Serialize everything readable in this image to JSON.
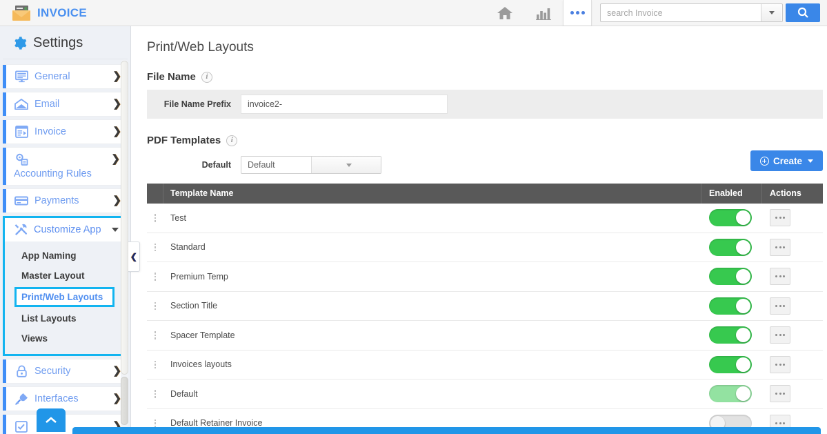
{
  "header": {
    "brand": "INVOICE",
    "logo_icon": "envelope-invoice-icon",
    "home_icon": "home-icon",
    "reports_icon": "bar-chart-icon",
    "more_icon": "more-horizontal-icon",
    "search": {
      "placeholder": "search Invoice",
      "value": "",
      "dropdown_icon": "chevron-down-icon",
      "button_icon": "search-icon"
    }
  },
  "sidebar": {
    "title": "Settings",
    "gear_icon": "gear-icon",
    "items": [
      {
        "label": "General",
        "icon": "monitor-icon",
        "chevron": "❯"
      },
      {
        "label": "Email",
        "icon": "envelope-icon",
        "chevron": "❯"
      },
      {
        "label": "Invoice",
        "icon": "invoice-document-icon",
        "chevron": "❯"
      },
      {
        "label": "Accounting Rules",
        "icon": "gears-icon",
        "chevron": "❯"
      },
      {
        "label": "Payments",
        "icon": "credit-card-icon",
        "chevron": "❯"
      }
    ],
    "customize": {
      "label": "Customize App",
      "icon": "tools-icon",
      "expanded": true,
      "submenu": [
        {
          "label": "App Naming",
          "active": false
        },
        {
          "label": "Master Layout",
          "active": false
        },
        {
          "label": "Print/Web Layouts",
          "active": true
        },
        {
          "label": "List Layouts",
          "active": false
        },
        {
          "label": "Views",
          "active": false
        }
      ]
    },
    "items_after": [
      {
        "label": "Security",
        "icon": "lock-icon",
        "chevron": "❯"
      },
      {
        "label": "Interfaces",
        "icon": "plug-icon",
        "chevron": "❯"
      }
    ],
    "collapse_handle_icon": "chevron-left-icon"
  },
  "main": {
    "page_title": "Print/Web Layouts",
    "file_name_section": {
      "heading": "File Name",
      "info_icon": "info-icon",
      "info_glyph": "i",
      "prefix_label": "File Name Prefix",
      "prefix_value": "invoice2-"
    },
    "pdf_templates_section": {
      "heading": "PDF Templates",
      "info_icon": "info-icon",
      "info_glyph": "i",
      "default_label": "Default",
      "default_value": "Default",
      "create_label": "Create",
      "create_icon": "plus-circle-icon"
    },
    "table": {
      "columns": [
        "Template Name",
        "Enabled",
        "Actions"
      ],
      "rows": [
        {
          "name": "Test",
          "enabled": "on",
          "actions_icon": "more-horizontal-icon"
        },
        {
          "name": "Standard",
          "enabled": "on",
          "actions_icon": "more-horizontal-icon"
        },
        {
          "name": "Premium Temp",
          "enabled": "on",
          "actions_icon": "more-horizontal-icon"
        },
        {
          "name": "Section Title",
          "enabled": "on",
          "actions_icon": "more-horizontal-icon"
        },
        {
          "name": "Spacer Template",
          "enabled": "on",
          "actions_icon": "more-horizontal-icon"
        },
        {
          "name": "Invoices layouts",
          "enabled": "on",
          "actions_icon": "more-horizontal-icon"
        },
        {
          "name": "Default",
          "enabled": "faded",
          "actions_icon": "more-horizontal-icon"
        },
        {
          "name": "Default Retainer Invoice",
          "enabled": "off",
          "actions_icon": "more-horizontal-icon"
        }
      ]
    },
    "scroll_top_icon": "chevron-up-icon"
  },
  "colors": {
    "brand_blue": "#4a90f0",
    "accent_blue": "#3a87e8",
    "highlight_cyan": "#12b4f0",
    "toggle_green": "#37c94f",
    "toggle_green_faded": "#93e2a1",
    "toggle_off": "#e2e2e2",
    "table_header": "#595959",
    "sidebar_bg": "#eef1f6"
  }
}
